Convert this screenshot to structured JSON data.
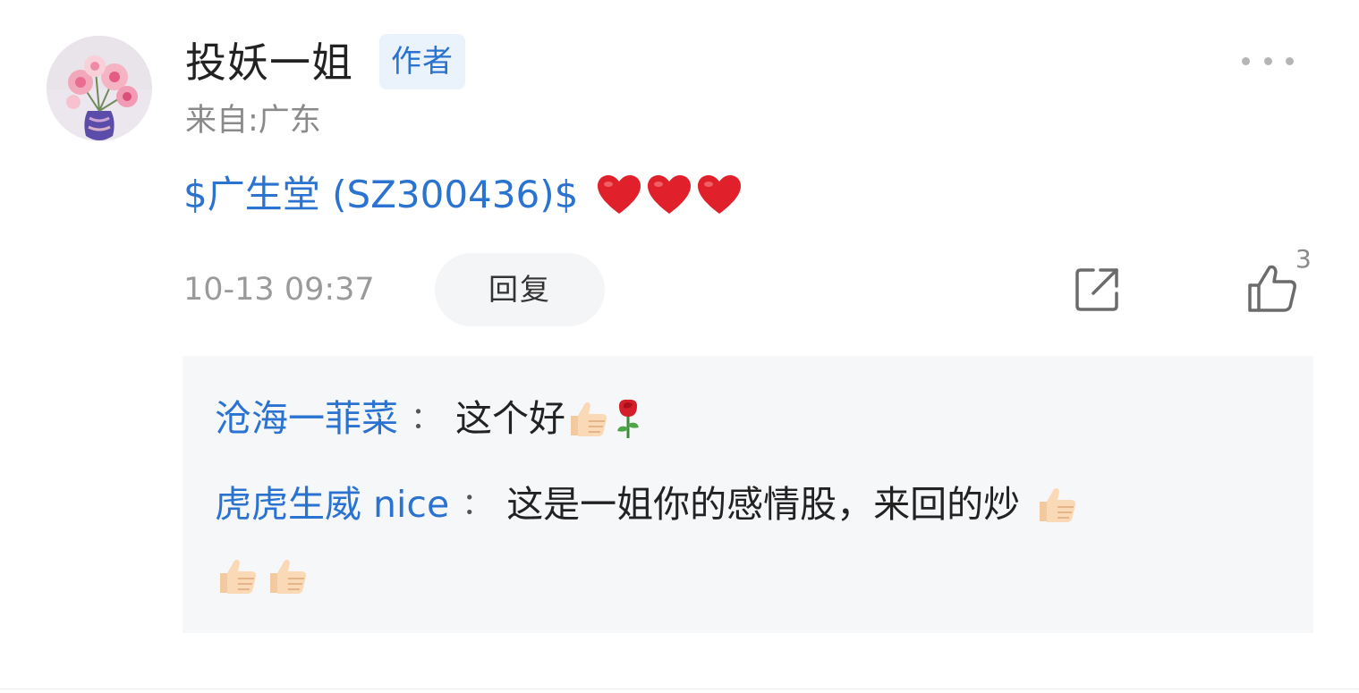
{
  "comment": {
    "username": "投妖一姐",
    "author_badge": "作者",
    "location": "来自:广东",
    "stock_link": "$广生堂 (SZ300436)$",
    "content_emojis": [
      "heart",
      "heart",
      "heart"
    ],
    "timestamp": "10-13 09:37",
    "reply_button_label": "回复",
    "like_count": "3",
    "icons": {
      "more": "more-icon",
      "share": "share-icon",
      "like": "thumbs-up-icon"
    },
    "colors": {
      "link_blue": "#2a73d0",
      "badge_bg": "#eaf2fc",
      "heart_red": "#e0202a",
      "reply_box_bg": "#f6f7f9"
    }
  },
  "replies": [
    {
      "author": "沧海一菲菜",
      "colon": "：",
      "text": "这个好",
      "emojis": [
        "thumbs-up",
        "rose"
      ]
    },
    {
      "author": "虎虎生威 nice",
      "colon": "：",
      "text": "这是一姐你的感情股，来回的炒",
      "emojis": [
        "thumbs-up",
        "thumbs-up",
        "thumbs-up"
      ]
    }
  ]
}
